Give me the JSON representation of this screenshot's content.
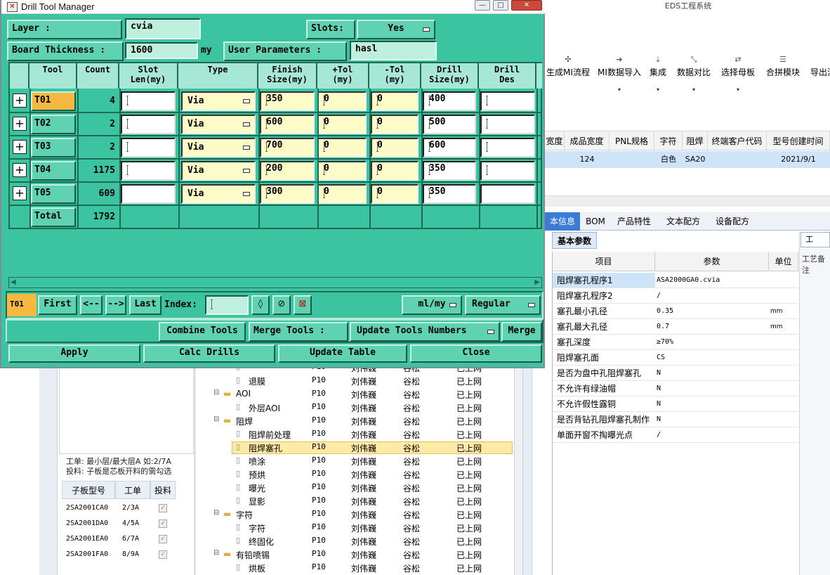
{
  "bg_app": {
    "title": "EDS工程系统",
    "toolbar": [
      {
        "label": "生成MI流程",
        "icon": "network-icon"
      },
      {
        "label": "MI数据导入",
        "icon": "import-icon"
      },
      {
        "label": "集成",
        "icon": "download-icon"
      },
      {
        "label": "数据对比",
        "icon": "compare-icon"
      },
      {
        "label": "选择母板",
        "icon": "shuffle-icon"
      },
      {
        "label": "合拼模块",
        "icon": "list-icon"
      },
      {
        "label": "导出流",
        "icon": ""
      }
    ],
    "grid_columns": [
      "宽度",
      "成品宽度",
      "PNL规格",
      "字符",
      "阻焊",
      "终端客户代码",
      "型号创建时间"
    ],
    "grid_row": [
      "",
      "124",
      "",
      "白色",
      "SA20",
      "",
      "2021/9/1"
    ],
    "tabs": [
      "本信息",
      "BOM",
      "产品特性",
      "文本配方",
      "设备配方"
    ],
    "sub_tab": "基本参数",
    "param_headers": [
      "项目",
      "参数",
      "单位"
    ],
    "params": [
      {
        "k": "阻焊塞孔程序1",
        "v": "ASA2000GA0.cvia",
        "u": ""
      },
      {
        "k": "阻焊塞孔程序2",
        "v": "/",
        "u": ""
      },
      {
        "k": "塞孔最小孔径",
        "v": "0.35",
        "u": "mm"
      },
      {
        "k": "塞孔最大孔径",
        "v": "0.7",
        "u": "mm"
      },
      {
        "k": "塞孔深度",
        "v": "≥70%",
        "u": ""
      },
      {
        "k": "阻焊塞孔面",
        "v": "CS",
        "u": ""
      },
      {
        "k": "是否为盘中孔阻焊塞孔",
        "v": "N",
        "u": ""
      },
      {
        "k": "不允许有绿油帽",
        "v": "N",
        "u": ""
      },
      {
        "k": "不允许假性露铜",
        "v": "N",
        "u": ""
      },
      {
        "k": "是否背钻孔阻焊塞孔制作",
        "v": "N",
        "u": ""
      },
      {
        "k": "单面开窗不掏曝光点",
        "v": "/",
        "u": ""
      }
    ],
    "right_tab": "工",
    "right_tab2": "工艺备注",
    "left_note": [
      "工单: 最小层/最大层A 如:2/7A",
      "投料: 子板是芯板开料的需勾选"
    ],
    "left_cols": [
      "子板型号",
      "工单",
      "投料"
    ],
    "left_rows": [
      {
        "model": "2SA2001CA0",
        "order": "2/3A"
      },
      {
        "model": "2SA2001DA0",
        "order": "4/5A"
      },
      {
        "model": "2SA2001EA0",
        "order": "6/7A"
      },
      {
        "model": "2SA2001FA0",
        "order": "8/9A"
      }
    ],
    "tree": [
      {
        "indent": 2,
        "name": "",
        "p": "P10",
        "who": "刘伟巍",
        "who2": "谷松",
        "state": "已上网"
      },
      {
        "indent": 2,
        "name": "退膜",
        "p": "P10",
        "who": "刘伟巍",
        "who2": "谷松",
        "state": "已上网"
      },
      {
        "indent": 1,
        "name": "AOI",
        "p": "P10",
        "who": "刘伟巍",
        "who2": "谷松",
        "state": "已上网",
        "folder": true
      },
      {
        "indent": 2,
        "name": "外层AOI",
        "p": "P10",
        "who": "刘伟巍",
        "who2": "谷松",
        "state": "已上网"
      },
      {
        "indent": 1,
        "name": "阻焊",
        "p": "P10",
        "who": "刘伟巍",
        "who2": "谷松",
        "state": "已上网",
        "folder": true
      },
      {
        "indent": 2,
        "name": "阻焊前处理",
        "p": "P10",
        "who": "刘伟巍",
        "who2": "谷松",
        "state": "已上网"
      },
      {
        "indent": 2,
        "name": "阻焊塞孔",
        "p": "P10",
        "who": "刘伟巍",
        "who2": "谷松",
        "state": "已上网"
      },
      {
        "indent": 2,
        "name": "喷涂",
        "p": "P10",
        "who": "刘伟巍",
        "who2": "谷松",
        "state": "已上网"
      },
      {
        "indent": 2,
        "name": "预烘",
        "p": "P10",
        "who": "刘伟巍",
        "who2": "谷松",
        "state": "已上网"
      },
      {
        "indent": 2,
        "name": "曝光",
        "p": "P10",
        "who": "刘伟巍",
        "who2": "谷松",
        "state": "已上网"
      },
      {
        "indent": 2,
        "name": "显影",
        "p": "P10",
        "who": "刘伟巍",
        "who2": "谷松",
        "state": "已上网"
      },
      {
        "indent": 1,
        "name": "字符",
        "p": "P10",
        "who": "刘伟巍",
        "who2": "谷松",
        "state": "已上网",
        "folder": true
      },
      {
        "indent": 2,
        "name": "字符",
        "p": "P10",
        "who": "刘伟巍",
        "who2": "谷松",
        "state": "已上网"
      },
      {
        "indent": 2,
        "name": "终固化",
        "p": "P10",
        "who": "刘伟巍",
        "who2": "谷松",
        "state": "已上网"
      },
      {
        "indent": 1,
        "name": "有铅喷锡",
        "p": "P10",
        "who": "刘伟巍",
        "who2": "谷松",
        "state": "已上网",
        "folder": true
      },
      {
        "indent": 2,
        "name": "烘板",
        "p": "P10",
        "who": "刘伟巍",
        "who2": "谷松",
        "state": "已上网"
      }
    ]
  },
  "dialog": {
    "title": "Drill Tool Manager",
    "layer_label": "Layer         :",
    "layer_value": "cvia",
    "slots_label": "Slots:",
    "slots_value": "Yes",
    "thickness_label": "Board Thickness :",
    "thickness_value": "1600",
    "thickness_unit": "my",
    "user_params_label": "User Parameters :",
    "user_params_value": "hasl",
    "columns": [
      "Tool",
      "Count",
      "Slot\nLen(my)",
      "Type",
      "Finish\nSize(my)",
      "+Tol\n(my)",
      "-Tol\n(my)",
      "Drill\nSize(my)",
      "Drill\nDes"
    ],
    "rows": [
      {
        "tool": "T01",
        "count": "4",
        "type": "Via",
        "finish": "350",
        "ptol": "0",
        "ntol": "0",
        "drill": "400",
        "selected": true
      },
      {
        "tool": "T02",
        "count": "2",
        "type": "Via",
        "finish": "600",
        "ptol": "0",
        "ntol": "0",
        "drill": "500"
      },
      {
        "tool": "T03",
        "count": "2",
        "type": "Via",
        "finish": "700",
        "ptol": "0",
        "ntol": "0",
        "drill": "600"
      },
      {
        "tool": "T04",
        "count": "1175",
        "type": "Via",
        "finish": "200",
        "ptol": "0",
        "ntol": "0",
        "drill": "350"
      },
      {
        "tool": "T05",
        "count": "609",
        "type": "Via",
        "finish": "300",
        "ptol": "0",
        "ntol": "0",
        "drill": "350"
      }
    ],
    "total_label": "Total",
    "total_count": "1792",
    "current_tool": "T01",
    "nav": {
      "first": "First",
      "prev": "<--",
      "next": "-->",
      "last": "Last",
      "index_label": "Index:"
    },
    "units_value": "ml/my",
    "mode_value": "Regular",
    "combine_label": "Combine Tools",
    "merge_label": "Merge Tools  :",
    "merge_select": "Update Tools Numbers",
    "merge_btn": "Merge",
    "apply": "Apply",
    "calc": "Calc Drills",
    "update": "Update Table",
    "close": "Close"
  },
  "colors": {
    "dialog_bg": "#3cc4a0",
    "selected_tool": "#f5b942",
    "header": "#a7e7d6"
  }
}
